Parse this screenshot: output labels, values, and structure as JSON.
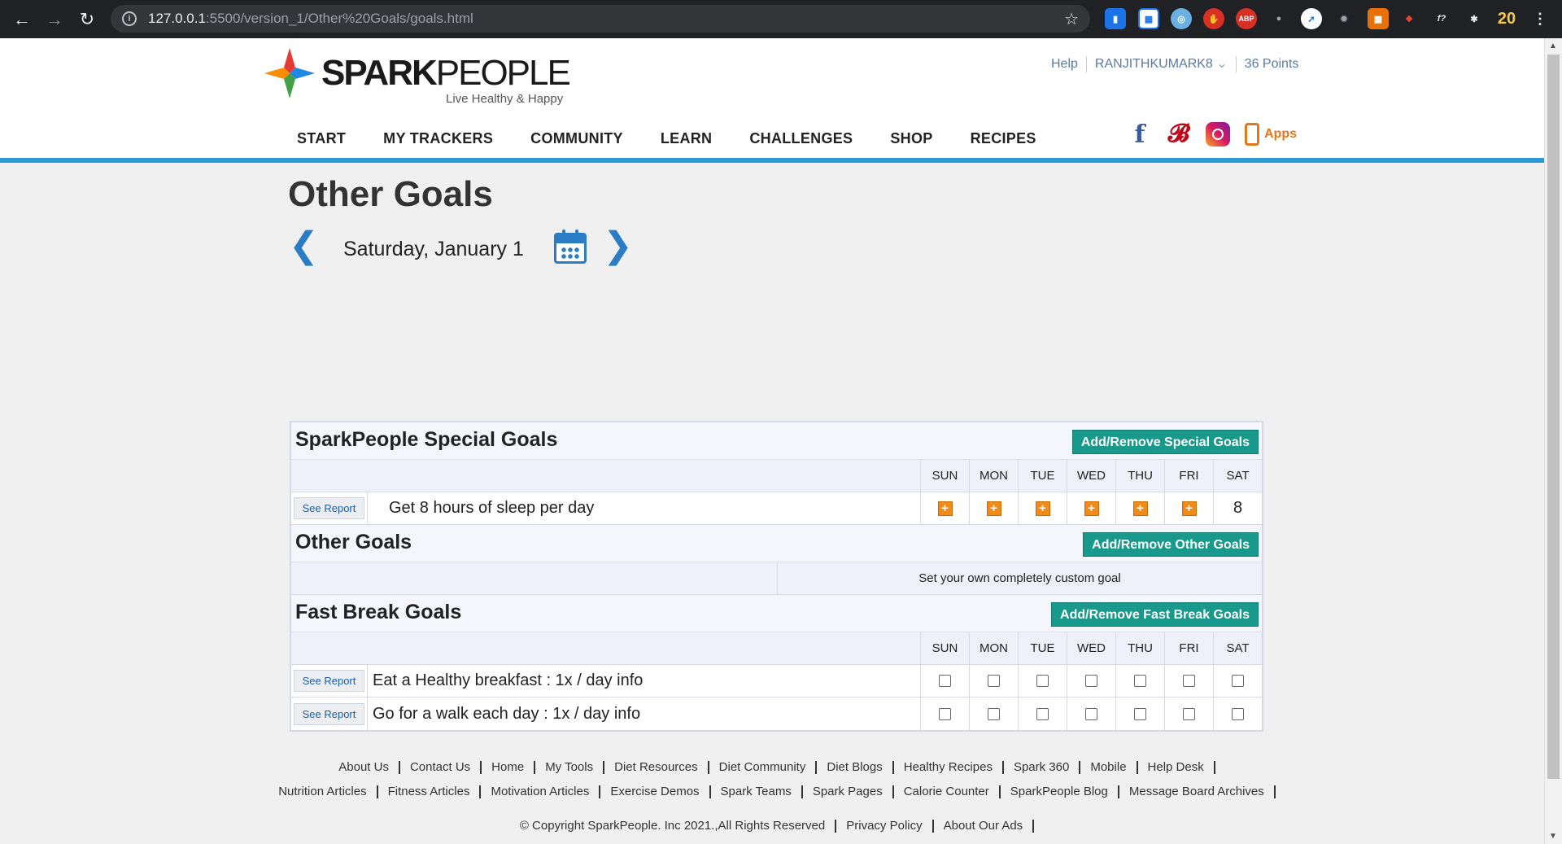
{
  "browser": {
    "url_host": "127.0.0.1",
    "url_path": ":5500/version_1/Other%20Goals/goals.html",
    "extension_badge": "20"
  },
  "header": {
    "logo_bold": "SPARK",
    "logo_light": "PEOPLE",
    "tagline": "Live Healthy & Happy",
    "top_links": [
      "Help",
      "RANJITHKUMARK8",
      "36 Points"
    ],
    "nav": [
      "START",
      "MY TRACKERS",
      "COMMUNITY",
      "LEARN",
      "CHALLENGES",
      "SHOP",
      "RECIPES"
    ],
    "apps_label": "Apps"
  },
  "page": {
    "title": "Other Goals",
    "date": "Saturday, January 1"
  },
  "days": [
    "SUN",
    "MON",
    "TUE",
    "WED",
    "THU",
    "FRI",
    "SAT"
  ],
  "special": {
    "title": "SparkPeople Special Goals",
    "button": "Add/Remove Special Goals",
    "see_report": "See Report",
    "goal": "Get 8 hours of sleep per day",
    "sat_value": "8"
  },
  "other": {
    "title": "Other Goals",
    "button": "Add/Remove Other Goals",
    "custom_text": "Set your own completely custom goal"
  },
  "fastbreak": {
    "title": "Fast Break Goals",
    "button": "Add/Remove Fast Break Goals",
    "see_report": "See Report",
    "goals": [
      "Eat a Healthy breakfast : 1x / day info",
      "Go for a walk each day : 1x / day info"
    ]
  },
  "footer": {
    "row1": [
      "About Us",
      "Contact Us",
      "Home",
      "My Tools",
      "Diet Resources",
      "Diet Community",
      "Diet Blogs",
      "Healthy Recipes",
      "Spark 360",
      "Mobile",
      "Help Desk"
    ],
    "row2": [
      "Nutrition Articles",
      "Fitness Articles",
      "Motivation Articles",
      "Exercise Demos",
      "Spark Teams",
      "Spark Pages",
      "Calorie Counter",
      "SparkPeople Blog",
      "Message Board Archives"
    ],
    "row3": [
      "© Copyright SparkPeople. Inc 2021.,All Rights Reserved",
      "Privacy Policy",
      "About Our Ads"
    ]
  }
}
